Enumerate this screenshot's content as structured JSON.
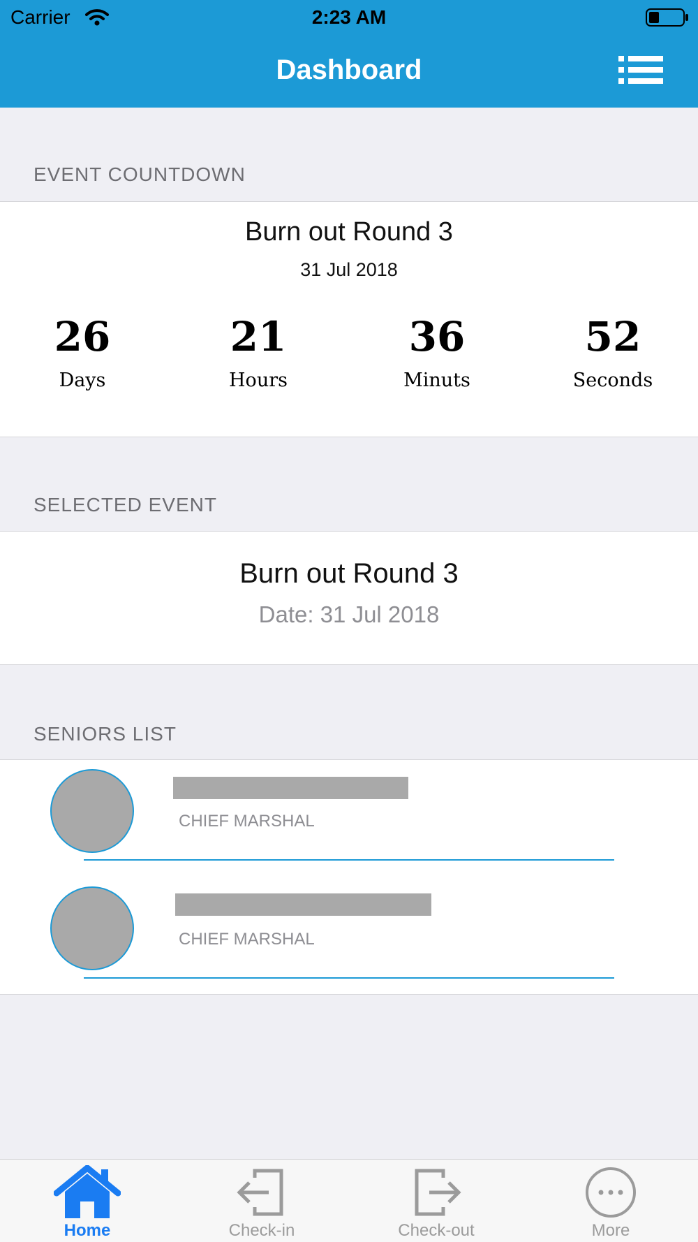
{
  "status_bar": {
    "carrier": "Carrier",
    "time": "2:23 AM"
  },
  "nav": {
    "title": "Dashboard",
    "menu_icon": "list-icon"
  },
  "countdown": {
    "header": "EVENT COUNTDOWN",
    "event_name": "Burn out  Round 3",
    "event_date": "31 Jul 2018",
    "units": [
      {
        "value": "26",
        "label": "Days"
      },
      {
        "value": "21",
        "label": "Hours"
      },
      {
        "value": "36",
        "label": "Minuts"
      },
      {
        "value": "52",
        "label": "Seconds"
      }
    ]
  },
  "selected_event": {
    "header": "SELECTED EVENT",
    "name": "Burn out  Round 3",
    "date": "Date: 31 Jul 2018"
  },
  "seniors": {
    "header": "SENIORS LIST",
    "items": [
      {
        "role": "CHIEF MARSHAL"
      },
      {
        "role": "CHIEF MARSHAL"
      }
    ]
  },
  "tabbar": {
    "tabs": [
      {
        "label": "Home",
        "icon": "home-icon",
        "active": true
      },
      {
        "label": "Check-in",
        "icon": "check-in-icon",
        "active": false
      },
      {
        "label": "Check-out",
        "icon": "check-out-icon",
        "active": false
      },
      {
        "label": "More",
        "icon": "more-icon",
        "active": false
      }
    ]
  },
  "colors": {
    "accent": "#1c9ad6",
    "tab_active": "#1a7cf2",
    "background": "#efeff4"
  }
}
